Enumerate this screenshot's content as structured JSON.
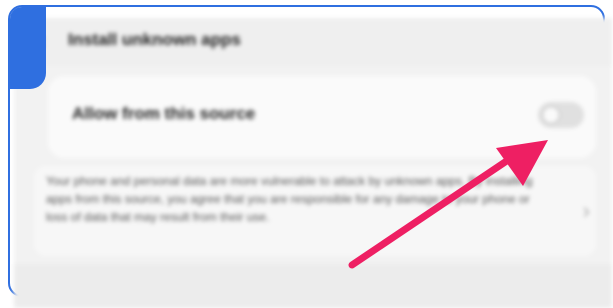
{
  "header": {
    "back_icon": "‹",
    "title": "Install unknown apps"
  },
  "setting": {
    "label": "Allow from this source",
    "toggle_state": "off"
  },
  "description": {
    "text": "Your phone and personal data are more vulnerable to attack by unknown apps. By installing apps from this source, you agree that you are responsible for any damage to your phone or loss of data that may result from their use."
  },
  "icons": {
    "chevron": "›"
  },
  "colors": {
    "frame_border": "#2f6fe0",
    "arrow": "#ee1f63"
  }
}
